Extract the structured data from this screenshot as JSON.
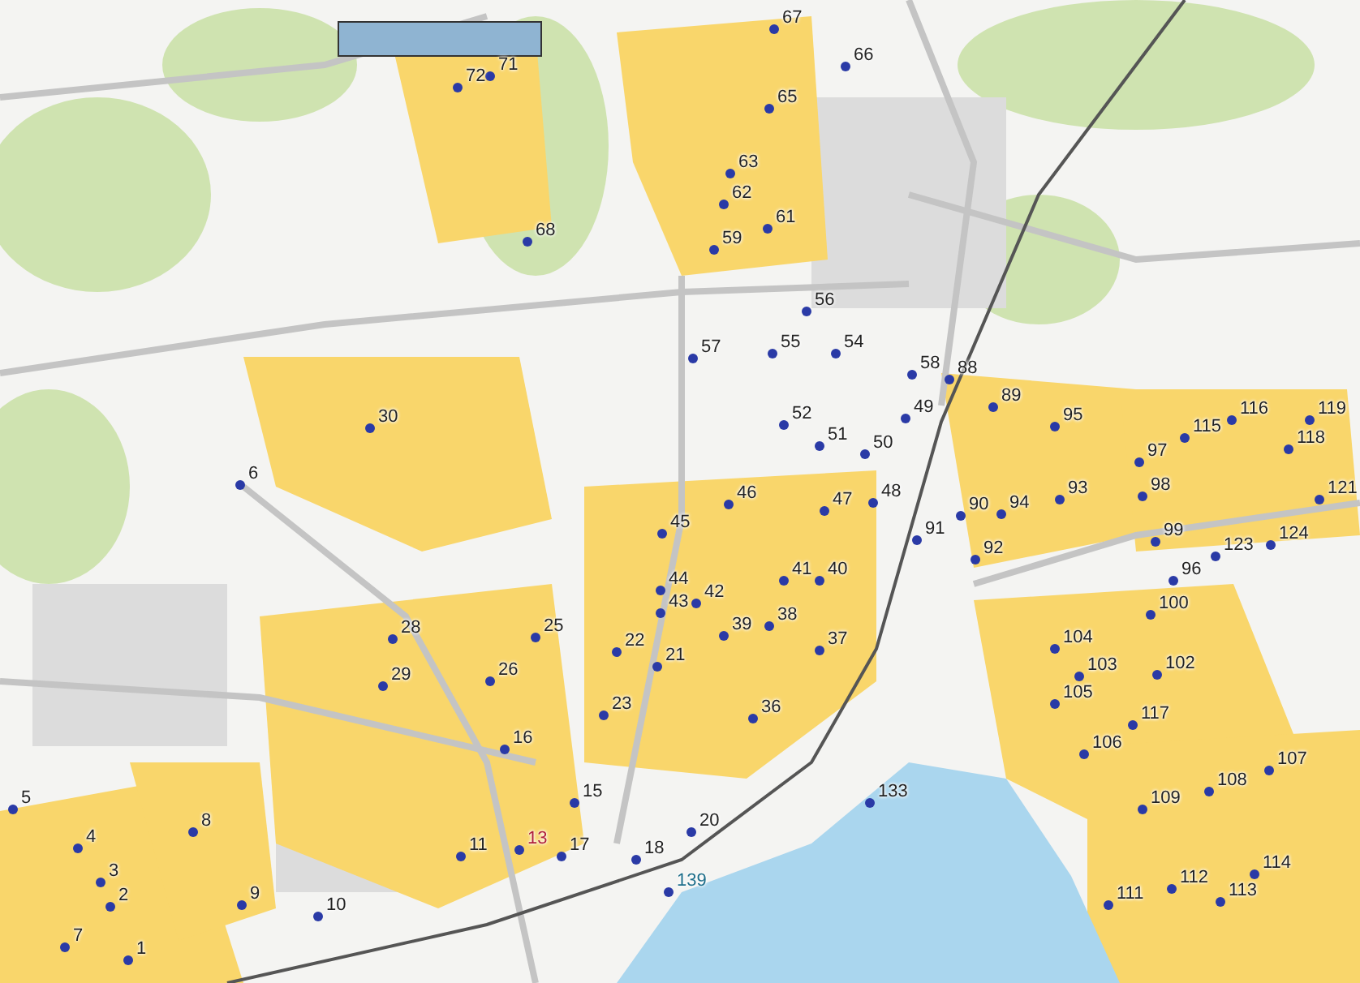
{
  "map": {
    "pins": [
      {
        "label": "67",
        "color": "#222222"
      },
      {
        "label": "66",
        "color": "#222222"
      },
      {
        "label": "71",
        "color": "#222222"
      },
      {
        "label": "72",
        "color": "#222222"
      },
      {
        "label": "65",
        "color": "#222222"
      },
      {
        "label": "63",
        "color": "#222222"
      },
      {
        "label": "62",
        "color": "#222222"
      },
      {
        "label": "61",
        "color": "#222222"
      },
      {
        "label": "68",
        "color": "#222222"
      },
      {
        "label": "59",
        "color": "#222222"
      },
      {
        "label": "56",
        "color": "#222222"
      },
      {
        "label": "57",
        "color": "#222222"
      },
      {
        "label": "55",
        "color": "#222222"
      },
      {
        "label": "54",
        "color": "#222222"
      },
      {
        "label": "58",
        "color": "#222222"
      },
      {
        "label": "88",
        "color": "#222222"
      },
      {
        "label": "89",
        "color": "#222222"
      },
      {
        "label": "30",
        "color": "#222222"
      },
      {
        "label": "52",
        "color": "#222222"
      },
      {
        "label": "49",
        "color": "#222222"
      },
      {
        "label": "95",
        "color": "#222222"
      },
      {
        "label": "116",
        "color": "#222222"
      },
      {
        "label": "119",
        "color": "#222222"
      },
      {
        "label": "51",
        "color": "#222222"
      },
      {
        "label": "50",
        "color": "#222222"
      },
      {
        "label": "97",
        "color": "#222222"
      },
      {
        "label": "115",
        "color": "#222222"
      },
      {
        "label": "118",
        "color": "#222222"
      },
      {
        "label": "6",
        "color": "#222222"
      },
      {
        "label": "46",
        "color": "#222222"
      },
      {
        "label": "47",
        "color": "#222222"
      },
      {
        "label": "48",
        "color": "#222222"
      },
      {
        "label": "90",
        "color": "#222222"
      },
      {
        "label": "94",
        "color": "#222222"
      },
      {
        "label": "93",
        "color": "#222222"
      },
      {
        "label": "98",
        "color": "#222222"
      },
      {
        "label": "121",
        "color": "#222222"
      },
      {
        "label": "45",
        "color": "#222222"
      },
      {
        "label": "91",
        "color": "#222222"
      },
      {
        "label": "92",
        "color": "#222222"
      },
      {
        "label": "99",
        "color": "#222222"
      },
      {
        "label": "123",
        "color": "#222222"
      },
      {
        "label": "124",
        "color": "#222222"
      },
      {
        "label": "44",
        "color": "#222222"
      },
      {
        "label": "41",
        "color": "#222222"
      },
      {
        "label": "40",
        "color": "#222222"
      },
      {
        "label": "96",
        "color": "#222222"
      },
      {
        "label": "43",
        "color": "#222222"
      },
      {
        "label": "42",
        "color": "#222222"
      },
      {
        "label": "100",
        "color": "#222222"
      },
      {
        "label": "38",
        "color": "#222222"
      },
      {
        "label": "28",
        "color": "#222222"
      },
      {
        "label": "25",
        "color": "#222222"
      },
      {
        "label": "22",
        "color": "#222222"
      },
      {
        "label": "39",
        "color": "#222222"
      },
      {
        "label": "37",
        "color": "#222222"
      },
      {
        "label": "104",
        "color": "#222222"
      },
      {
        "label": "29",
        "color": "#222222"
      },
      {
        "label": "26",
        "color": "#222222"
      },
      {
        "label": "21",
        "color": "#222222"
      },
      {
        "label": "103",
        "color": "#222222"
      },
      {
        "label": "102",
        "color": "#222222"
      },
      {
        "label": "23",
        "color": "#222222"
      },
      {
        "label": "36",
        "color": "#222222"
      },
      {
        "label": "105",
        "color": "#222222"
      },
      {
        "label": "117",
        "color": "#222222"
      },
      {
        "label": "16",
        "color": "#222222"
      },
      {
        "label": "106",
        "color": "#222222"
      },
      {
        "label": "107",
        "color": "#222222"
      },
      {
        "label": "5",
        "color": "#222222"
      },
      {
        "label": "15",
        "color": "#222222"
      },
      {
        "label": "133",
        "color": "#222222"
      },
      {
        "label": "109",
        "color": "#222222"
      },
      {
        "label": "108",
        "color": "#222222"
      },
      {
        "label": "8",
        "color": "#222222"
      },
      {
        "label": "20",
        "color": "#222222"
      },
      {
        "label": "4",
        "color": "#222222"
      },
      {
        "label": "11",
        "color": "#222222"
      },
      {
        "label": "13",
        "color": "#b0203a"
      },
      {
        "label": "17",
        "color": "#222222"
      },
      {
        "label": "18",
        "color": "#222222"
      },
      {
        "label": "114",
        "color": "#222222"
      },
      {
        "label": "3",
        "color": "#222222"
      },
      {
        "label": "139",
        "color": "#1f6f8b"
      },
      {
        "label": "112",
        "color": "#222222"
      },
      {
        "label": "2",
        "color": "#222222"
      },
      {
        "label": "9",
        "color": "#222222"
      },
      {
        "label": "10",
        "color": "#222222"
      },
      {
        "label": "111",
        "color": "#222222"
      },
      {
        "label": "113",
        "color": "#222222"
      },
      {
        "label": "7",
        "color": "#222222"
      },
      {
        "label": "1",
        "color": "#222222"
      }
    ]
  }
}
